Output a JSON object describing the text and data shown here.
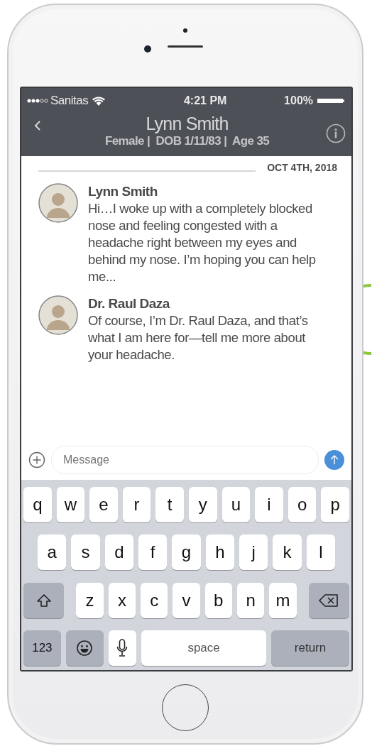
{
  "status_bar": {
    "carrier": "Sanitas",
    "time": "4:21 PM",
    "battery": "100%"
  },
  "header": {
    "title": "Lynn Smith",
    "subtitle": "Female |  DOB 1/11/83 |  Age 35"
  },
  "date": "OCT 4TH, 2018",
  "messages": [
    {
      "sender": "Lynn Smith",
      "text": "Hi…I woke up with a completely blocked nose and feeling congested with a headache right between my eyes and behind my nose. I’m hoping you can help me..."
    },
    {
      "sender": "Dr. Raul Daza",
      "text": "Of course, I’m Dr. Raul Daza, and that’s what I am here for—tell me more about your headache."
    }
  ],
  "composer": {
    "placeholder": "Message"
  },
  "keyboard": [
    [
      {
        "kind": "letter",
        "label": "q"
      },
      {
        "kind": "letter",
        "label": "w"
      },
      {
        "kind": "letter",
        "label": "e"
      },
      {
        "kind": "letter",
        "label": "r"
      },
      {
        "kind": "letter",
        "label": "t"
      },
      {
        "kind": "letter",
        "label": "y"
      },
      {
        "kind": "letter",
        "label": "u"
      },
      {
        "kind": "letter",
        "label": "i"
      },
      {
        "kind": "letter",
        "label": "o"
      },
      {
        "kind": "letter",
        "label": "p"
      }
    ],
    [
      {
        "kind": "letter",
        "label": "a"
      },
      {
        "kind": "letter",
        "label": "s"
      },
      {
        "kind": "letter",
        "label": "d"
      },
      {
        "kind": "letter",
        "label": "f"
      },
      {
        "kind": "letter",
        "label": "g"
      },
      {
        "kind": "letter",
        "label": "h"
      },
      {
        "kind": "letter",
        "label": "j"
      },
      {
        "kind": "letter",
        "label": "k"
      },
      {
        "kind": "letter",
        "label": "l"
      }
    ],
    [
      {
        "kind": "shift"
      },
      {
        "kind": "letter",
        "label": "z"
      },
      {
        "kind": "letter",
        "label": "x"
      },
      {
        "kind": "letter",
        "label": "c"
      },
      {
        "kind": "letter",
        "label": "v"
      },
      {
        "kind": "letter",
        "label": "b"
      },
      {
        "kind": "letter",
        "label": "n"
      },
      {
        "kind": "letter",
        "label": "m"
      },
      {
        "kind": "delete"
      }
    ],
    [
      {
        "kind": "numbers",
        "label": "123"
      },
      {
        "kind": "emoji"
      },
      {
        "kind": "mic"
      },
      {
        "kind": "space",
        "label": "space"
      },
      {
        "kind": "return",
        "label": "return"
      }
    ]
  ]
}
